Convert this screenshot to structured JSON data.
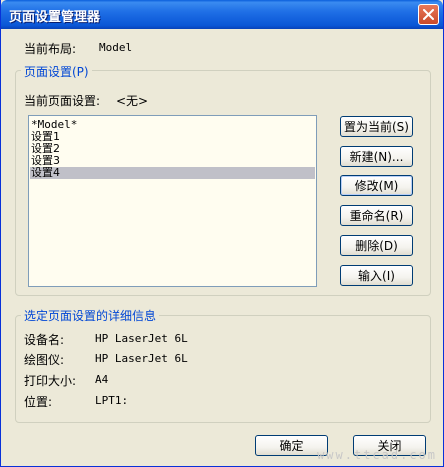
{
  "window": {
    "title": "页面设置管理器"
  },
  "current_layout": {
    "label": "当前布局:",
    "value": "Model"
  },
  "page_setup_group": {
    "title": "页面设置(P)",
    "current_label": "当前页面设置:",
    "current_value": "<无>",
    "items": [
      "*Model*",
      "设置1",
      "设置2",
      "设置3",
      "设置4"
    ],
    "selected_index": 4
  },
  "buttons": {
    "set_current": "置为当前(S)",
    "new": "新建(N)...",
    "modify": "修改(M)",
    "rename": "重命名(R)",
    "delete": "删除(D)",
    "import": "输入(I)"
  },
  "details_group": {
    "title": "选定页面设置的详细信息",
    "rows": [
      {
        "label": "设备名:",
        "value": "HP LaserJet 6L"
      },
      {
        "label": "绘图仪:",
        "value": "HP LaserJet 6L"
      },
      {
        "label": "打印大小:",
        "value": "A4"
      },
      {
        "label": "位置:",
        "value": "LPT1:"
      }
    ]
  },
  "footer": {
    "ok": "确定",
    "close": "关闭"
  },
  "watermark": "www.ttcad.com"
}
